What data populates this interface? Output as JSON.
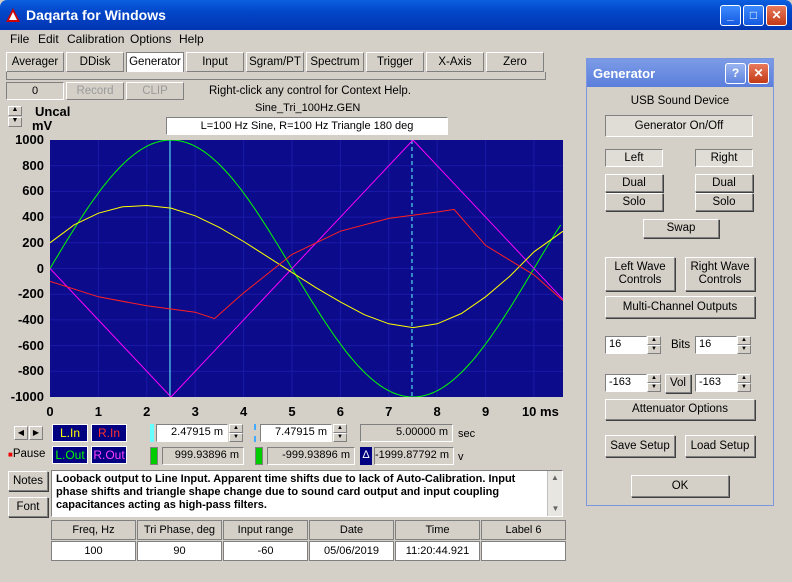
{
  "window": {
    "title": "Daqarta for Windows"
  },
  "menu": [
    "File",
    "Edit",
    "Calibration",
    "Options",
    "Help"
  ],
  "tabs": [
    "Averager",
    "DDisk",
    "Generator",
    "Input",
    "Sgram/PT",
    "Spectrum",
    "Trigger",
    "X-Axis",
    "Zero"
  ],
  "toolbar": {
    "counter": "0",
    "record": "Record",
    "clip": "CLIP",
    "hint": "Right-click any control for Context Help."
  },
  "plot": {
    "file": "Sine_Tri_100Hz.GEN",
    "caption": "L=100 Hz Sine, R=100 Hz Triangle 180 deg",
    "units_top": "Uncal",
    "units_bottom": "mV",
    "yticks": [
      "1000",
      "800",
      "600",
      "400",
      "200",
      "0",
      "-200",
      "-400",
      "-600",
      "-800",
      "-1000"
    ],
    "xticks": [
      "0",
      "1",
      "2",
      "3",
      "4",
      "5",
      "6",
      "7",
      "8",
      "9",
      "10 ms"
    ]
  },
  "chart_data": {
    "type": "line",
    "x_range_ms": [
      0,
      10.6
    ],
    "ylim": [
      -1000,
      1000
    ],
    "series": [
      {
        "name": "L.Out",
        "color": "#00ff00",
        "x": [
          0,
          2.5,
          7.5,
          10.6
        ],
        "y": [
          0,
          1000,
          -1000,
          370
        ]
      },
      {
        "name": "R.Out",
        "color": "#ff00ff",
        "x": [
          0,
          2.5,
          7.5,
          10.6
        ],
        "y": [
          0,
          -1000,
          1000,
          -240
        ]
      },
      {
        "name": "L.In",
        "color": "#ffff00",
        "x": [
          0,
          0.5,
          1,
          1.5,
          2,
          2.5,
          3,
          3.5,
          4,
          4.5,
          5,
          5.5,
          6,
          6.5,
          7,
          7.5,
          8,
          8.5,
          9,
          9.5,
          10,
          10.6
        ],
        "y": [
          200,
          340,
          430,
          480,
          490,
          470,
          410,
          320,
          210,
          90,
          -30,
          -150,
          -260,
          -360,
          -430,
          -460,
          -430,
          -350,
          -220,
          -60,
          130,
          290
        ]
      },
      {
        "name": "R.In",
        "color": "#ff2020",
        "x": [
          0,
          1,
          2,
          3,
          3.4,
          4,
          5,
          6,
          7,
          8,
          8.35,
          9,
          10,
          10.6
        ],
        "y": [
          -100,
          -220,
          -290,
          -340,
          -390,
          -190,
          110,
          290,
          390,
          440,
          460,
          180,
          -50,
          -250
        ]
      }
    ],
    "cursors_ms": [
      2.47915,
      7.47915
    ]
  },
  "readouts": {
    "t1": "2.47915 m",
    "t2": "7.47915 m",
    "dt": "5.00000 m",
    "dt_unit": "sec",
    "v1": "999.93896 m",
    "v2": "-999.93896 m",
    "dv": "-1999.87792 m",
    "dv_unit": "v"
  },
  "channels": {
    "lin": "L.In",
    "rin": "R.In",
    "lout": "L.Out",
    "rout": "R.Out",
    "pause": "Pause"
  },
  "notes": {
    "notes_btn": "Notes",
    "font_btn": "Font",
    "text": "Looback output to Line Input.  Apparent time shifts due to lack of Auto-Calibration. Input phase shifts and triangle shape change due to sound card output and input coupling capacitances acting as high-pass filters."
  },
  "table": {
    "headers": [
      "Freq, Hz",
      "Tri Phase, deg",
      "Input range",
      "Date",
      "Time",
      "Label 6"
    ],
    "values": [
      "100",
      "90",
      "-60",
      "05/06/2019",
      "11:20:44.921",
      ""
    ]
  },
  "generator": {
    "title": "Generator",
    "device": "USB Sound Device",
    "on_off": "Generator On/Off",
    "left": "Left",
    "right": "Right",
    "dual": "Dual",
    "solo": "Solo",
    "swap": "Swap",
    "left_wave": "Left Wave Controls",
    "right_wave": "Right Wave Controls",
    "multi": "Multi-Channel Outputs",
    "bits_left": "16",
    "bits_label": "Bits",
    "bits_right": "16",
    "vol_left": "-163",
    "vol_label": "Vol",
    "vol_right": "-163",
    "attn": "Attenuator Options",
    "save": "Save Setup",
    "load": "Load Setup",
    "ok": "OK"
  }
}
